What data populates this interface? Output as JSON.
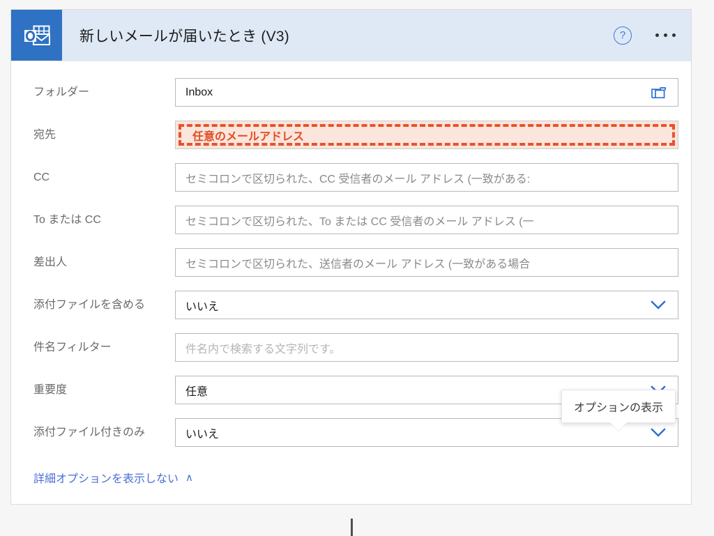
{
  "header": {
    "title": "新しいメールが届いたとき (V3)",
    "app_icon": "outlook-icon",
    "help_label": "?",
    "help_icon": "help-circle-icon",
    "more_icon": "more-horizontal-icon",
    "accent_color": "#2f72c4",
    "background_color": "#dfe8f5"
  },
  "fields": [
    {
      "label": "フォルダー",
      "value": "Inbox",
      "placeholder": "",
      "type": "picker",
      "icon": "folder-icon",
      "state": "filled"
    },
    {
      "label": "宛先",
      "value": "任意のメールアドレス",
      "placeholder": "",
      "type": "text",
      "icon": "",
      "state": "highlighted",
      "highlight_border_color": "#e8522a",
      "highlight_fill_color": "#fbe5dd",
      "highlight_text_color": "#e04e20"
    },
    {
      "label": "CC",
      "value": "",
      "placeholder": "セミコロンで区切られた、CC 受信者のメール アドレス (一致がある:",
      "type": "text",
      "icon": "",
      "state": "placeholder"
    },
    {
      "label": "To または CC",
      "value": "",
      "placeholder": "セミコロンで区切られた、To または CC 受信者のメール アドレス (一",
      "type": "text",
      "icon": "",
      "state": "placeholder"
    },
    {
      "label": "差出人",
      "value": "",
      "placeholder": "セミコロンで区切られた、送信者のメール アドレス (一致がある場合",
      "type": "text",
      "icon": "",
      "state": "placeholder"
    },
    {
      "label": "添付ファイルを含める",
      "value": "いいえ",
      "placeholder": "",
      "type": "dropdown",
      "icon": "chevron-down-icon",
      "state": "filled"
    },
    {
      "label": "件名フィルター",
      "value": "",
      "placeholder": "件名内で検索する文字列です。",
      "type": "text",
      "icon": "",
      "state": "placeholder-light"
    },
    {
      "label": "重要度",
      "value": "任意",
      "placeholder": "",
      "type": "dropdown",
      "icon": "chevron-down-icon",
      "state": "filled"
    },
    {
      "label": "添付ファイル付きのみ",
      "value": "いいえ",
      "placeholder": "",
      "type": "dropdown",
      "icon": "chevron-down-icon",
      "state": "filled"
    }
  ],
  "tooltip": {
    "text": "オプションの表示",
    "attached_to": "添付ファイル付きのみ"
  },
  "footer": {
    "advanced_options_label": "詳細オプションを表示しない",
    "caret": "∧",
    "link_color": "#4a6fd4"
  }
}
